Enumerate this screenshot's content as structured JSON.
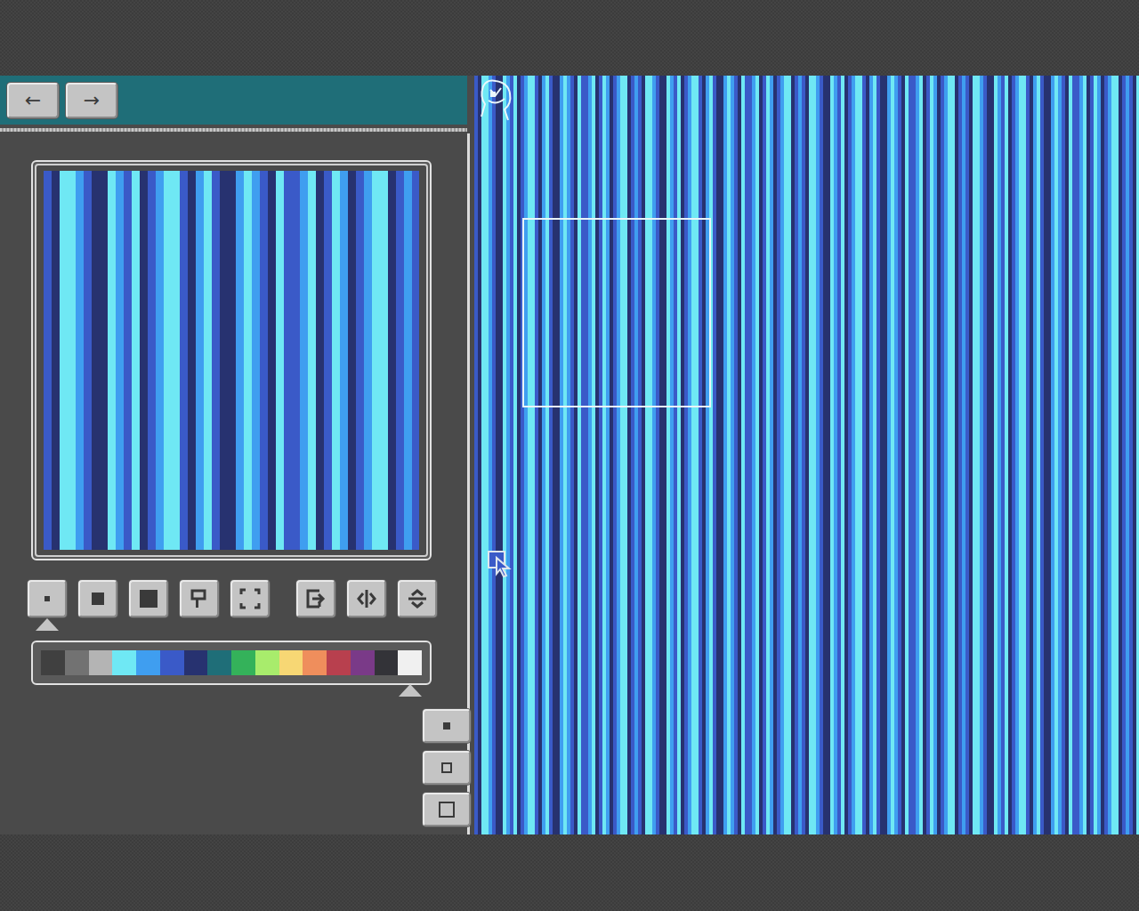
{
  "nav": [
    {
      "label": "←"
    },
    {
      "label": "→"
    }
  ],
  "tools": [
    {
      "kind": "dot",
      "selected": true
    },
    {
      "kind": "square",
      "selected": false
    },
    {
      "kind": "big-square",
      "selected": false
    },
    {
      "kind": "brush",
      "selected": false
    },
    {
      "kind": "select",
      "selected": false
    },
    {
      "kind": "import",
      "selected": false
    },
    {
      "kind": "flip-h",
      "selected": false
    },
    {
      "kind": "flip-v",
      "selected": false
    }
  ],
  "palette": [
    {
      "color": "#404040",
      "selected": false
    },
    {
      "color": "#727272",
      "selected": false
    },
    {
      "color": "#b4b4b4",
      "selected": false
    },
    {
      "color": "#6fe8f4",
      "selected": false
    },
    {
      "color": "#3f9ef0",
      "selected": false
    },
    {
      "color": "#3a5ac8",
      "selected": false
    },
    {
      "color": "#273270",
      "selected": false
    },
    {
      "color": "#1f6e78",
      "selected": false
    },
    {
      "color": "#34b25a",
      "selected": false
    },
    {
      "color": "#a8ec6c",
      "selected": false
    },
    {
      "color": "#f7d774",
      "selected": false
    },
    {
      "color": "#ef8e5c",
      "selected": false
    },
    {
      "color": "#b8404e",
      "selected": false
    },
    {
      "color": "#7a3a88",
      "selected": false
    },
    {
      "color": "#333338",
      "selected": false
    },
    {
      "color": "#f0f0f0",
      "selected": true
    }
  ],
  "zoom": [
    {
      "kind": "small"
    },
    {
      "kind": "medium"
    },
    {
      "kind": "large"
    }
  ],
  "canvas": {
    "stripes": [
      "#3a5ac8",
      "#273270",
      "#6fe8f4",
      "#6fe8f4",
      "#3f9ef0",
      "#3a5ac8",
      "#273270",
      "#273270",
      "#6fe8f4",
      "#3f9ef0",
      "#3a5ac8",
      "#6fe8f4",
      "#273270",
      "#3a5ac8",
      "#3f9ef0",
      "#6fe8f4",
      "#6fe8f4",
      "#3a5ac8",
      "#273270",
      "#3f9ef0",
      "#6fe8f4",
      "#3a5ac8",
      "#273270",
      "#273270",
      "#3f9ef0",
      "#6fe8f4",
      "#3f9ef0",
      "#3a5ac8",
      "#273270",
      "#6fe8f4",
      "#3a5ac8",
      "#3a5ac8",
      "#3f9ef0",
      "#6fe8f4",
      "#273270",
      "#3a5ac8",
      "#6fe8f4",
      "#3f9ef0",
      "#273270",
      "#3a5ac8",
      "#3f9ef0",
      "#6fe8f4",
      "#6fe8f4",
      "#273270",
      "#3a5ac8",
      "#3f9ef0"
    ]
  }
}
